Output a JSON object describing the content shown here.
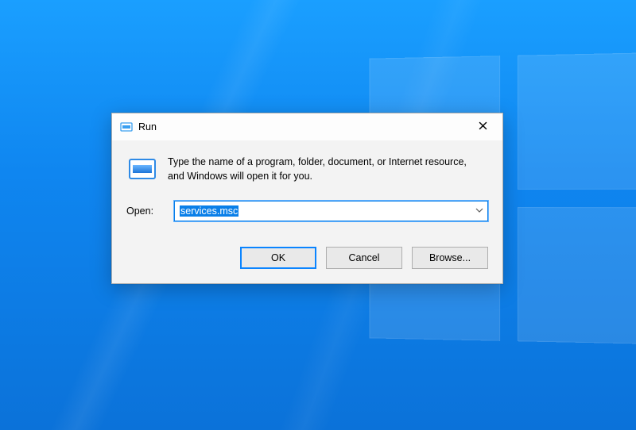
{
  "dialog": {
    "title": "Run",
    "description": "Type the name of a program, folder, document, or Internet resource, and Windows will open it for you.",
    "open_label": "Open:",
    "input_value": "services.msc",
    "buttons": {
      "ok": "OK",
      "cancel": "Cancel",
      "browse": "Browse..."
    }
  },
  "colors": {
    "accent": "#0a7fe8",
    "window_bg": "#f3f3f3"
  }
}
